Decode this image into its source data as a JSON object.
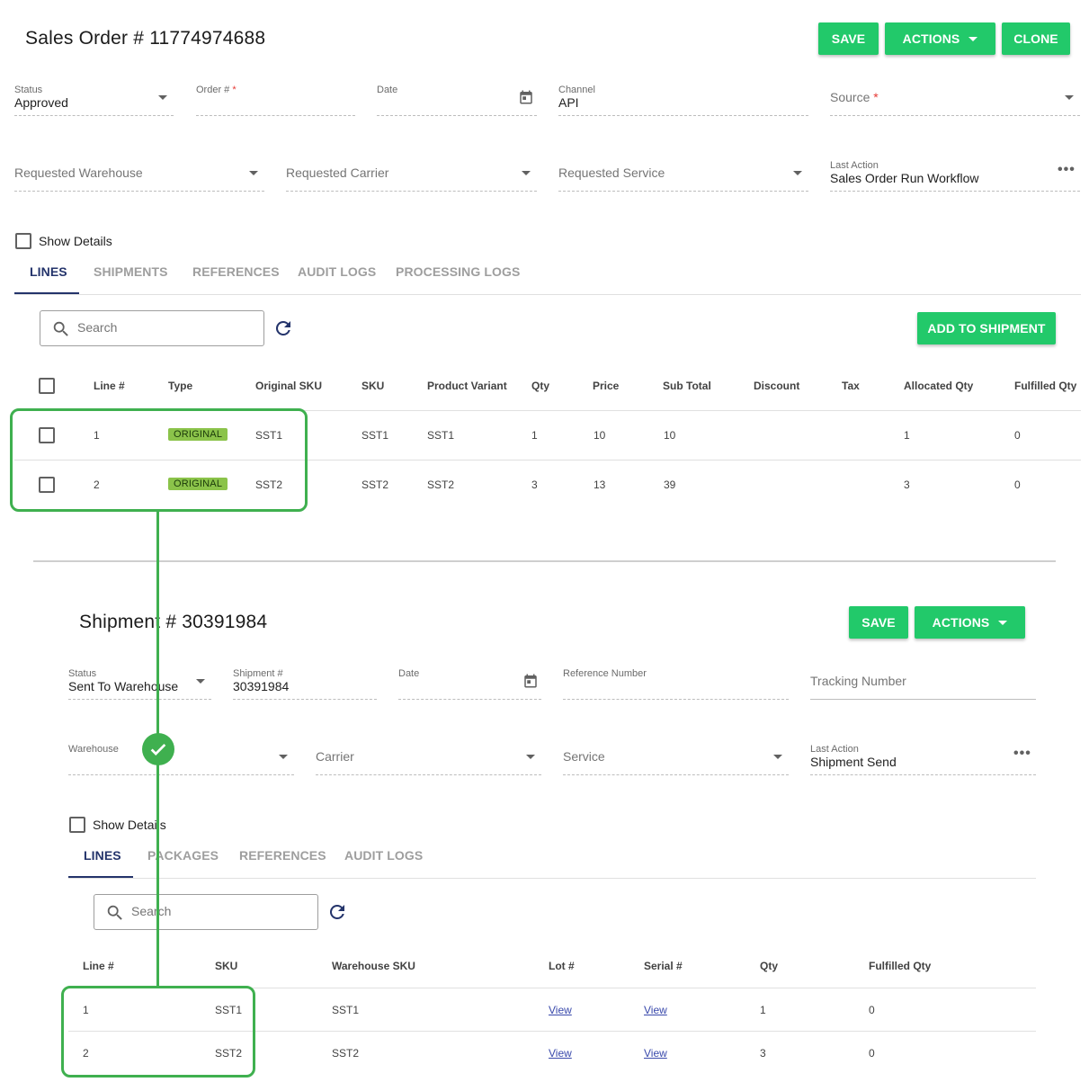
{
  "sales_order": {
    "title": "Sales Order # 11774974688",
    "buttons": {
      "save": "SAVE",
      "actions": "ACTIONS",
      "clone": "CLONE"
    },
    "fields": {
      "status": {
        "label": "Status",
        "value": "Approved"
      },
      "order_no": {
        "label": "Order #",
        "required": "*",
        "value": ""
      },
      "date": {
        "label": "Date",
        "value": ""
      },
      "channel": {
        "label": "Channel",
        "value": "API"
      },
      "source": {
        "placeholder": "Source",
        "required": "*"
      },
      "requested_warehouse": {
        "placeholder": "Requested Warehouse"
      },
      "requested_carrier": {
        "placeholder": "Requested Carrier"
      },
      "requested_service": {
        "placeholder": "Requested Service"
      },
      "last_action": {
        "label": "Last Action",
        "value": "Sales Order Run Workflow"
      }
    },
    "show_details": "Show Details",
    "tabs": [
      "LINES",
      "SHIPMENTS",
      "REFERENCES",
      "AUDIT LOGS",
      "PROCESSING LOGS"
    ],
    "search_placeholder": "Search",
    "add_to_shipment": "ADD TO SHIPMENT",
    "table": {
      "headers": [
        "Line #",
        "Type",
        "Original SKU",
        "SKU",
        "Product Variant",
        "Qty",
        "Price",
        "Sub Total",
        "Discount",
        "Tax",
        "Allocated Qty",
        "Fulfilled Qty"
      ],
      "rows": [
        {
          "line": "1",
          "type": "ORIGINAL",
          "original_sku": "SST1",
          "sku": "SST1",
          "variant": "SST1",
          "qty": "1",
          "price": "10",
          "subtotal": "10",
          "discount": "",
          "tax": "",
          "allocated": "1",
          "fulfilled": "0"
        },
        {
          "line": "2",
          "type": "ORIGINAL",
          "original_sku": "SST2",
          "sku": "SST2",
          "variant": "SST2",
          "qty": "3",
          "price": "13",
          "subtotal": "39",
          "discount": "",
          "tax": "",
          "allocated": "3",
          "fulfilled": "0"
        }
      ]
    }
  },
  "shipment": {
    "title": "Shipment # 30391984",
    "buttons": {
      "save": "SAVE",
      "actions": "ACTIONS"
    },
    "fields": {
      "status": {
        "label": "Status",
        "value": "Sent To Warehouse"
      },
      "shipment_no": {
        "label": "Shipment #",
        "value": "30391984"
      },
      "date": {
        "label": "Date",
        "value": ""
      },
      "reference_number": {
        "label": "Reference Number",
        "value": ""
      },
      "tracking_number": {
        "placeholder": "Tracking Number"
      },
      "warehouse": {
        "label": "Warehouse",
        "value": ""
      },
      "carrier": {
        "placeholder": "Carrier"
      },
      "service": {
        "placeholder": "Service"
      },
      "last_action": {
        "label": "Last Action",
        "value": "Shipment Send"
      }
    },
    "show_details": "Show Details",
    "tabs": [
      "LINES",
      "PACKAGES",
      "REFERENCES",
      "AUDIT LOGS"
    ],
    "search_placeholder": "Search",
    "table": {
      "headers": [
        "Line #",
        "SKU",
        "Warehouse SKU",
        "Lot #",
        "Serial #",
        "Qty",
        "Fulfilled Qty"
      ],
      "rows": [
        {
          "line": "1",
          "sku": "SST1",
          "warehouse_sku": "SST1",
          "lot": "View",
          "serial": "View",
          "qty": "1",
          "fulfilled": "0"
        },
        {
          "line": "2",
          "sku": "SST2",
          "warehouse_sku": "SST2",
          "lot": "View",
          "serial": "View",
          "qty": "3",
          "fulfilled": "0"
        }
      ]
    }
  },
  "colors": {
    "accent_green": "#22c96a",
    "highlight_green": "#3fb04f",
    "tab_active": "#24346b",
    "badge_green": "#8bc34a",
    "link": "#3949ab"
  },
  "icons": [
    "calendar-icon",
    "search-icon",
    "refresh-icon",
    "checkmark-icon",
    "more-horiz-icon",
    "dropdown-caret-icon"
  ]
}
